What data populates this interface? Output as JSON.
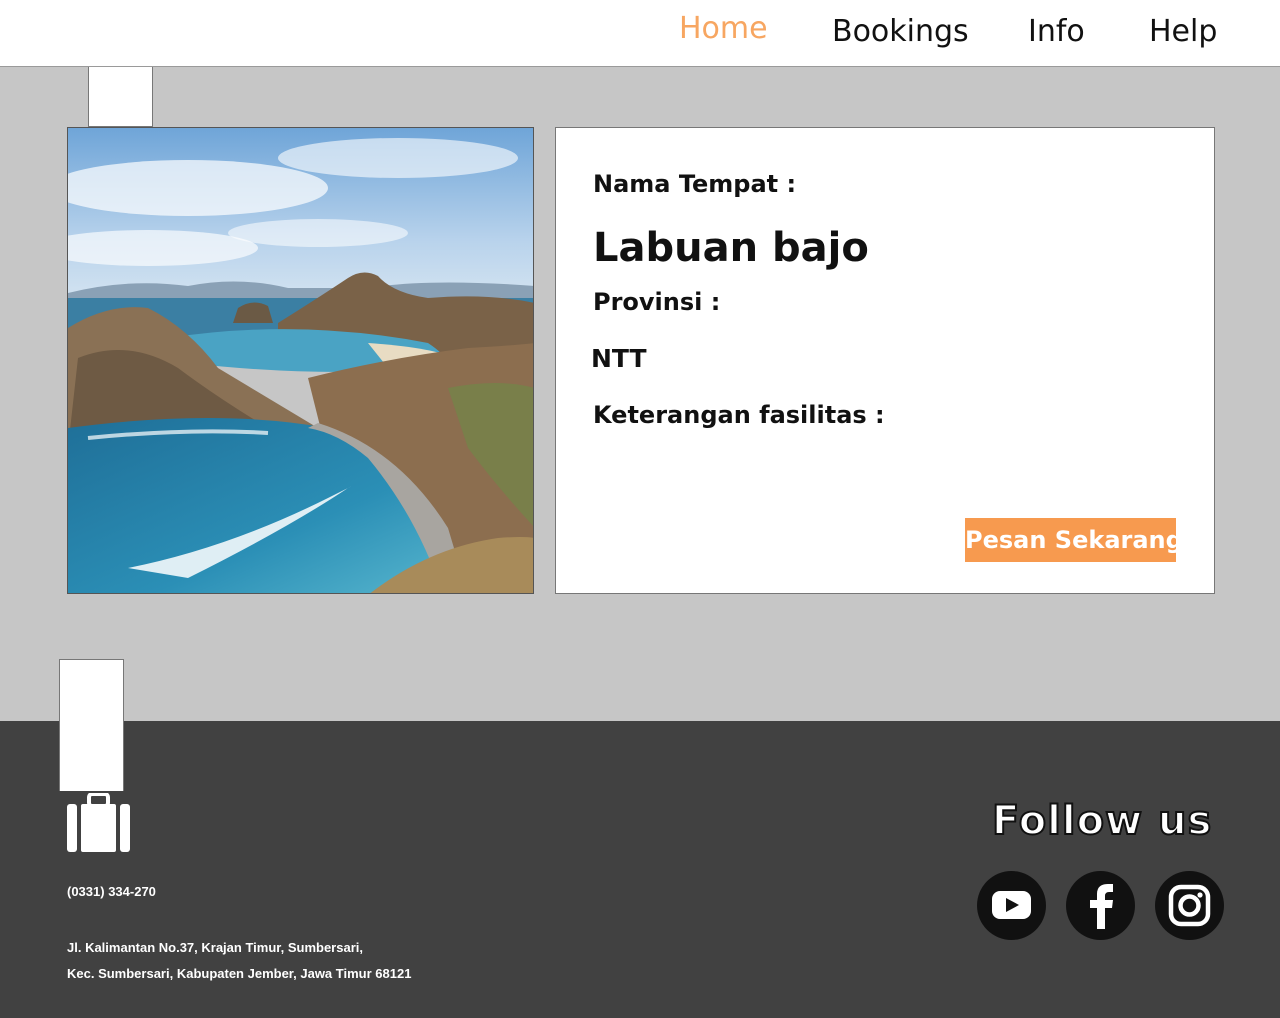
{
  "nav": {
    "items": [
      {
        "label": "Home",
        "active": true
      },
      {
        "label": "Bookings",
        "active": false
      },
      {
        "label": "Info",
        "active": false
      },
      {
        "label": "Help",
        "active": false
      }
    ],
    "active_color": "#f7a661"
  },
  "destination": {
    "name_label": "Nama Tempat :",
    "name_value": "Labuan bajo",
    "province_label": "Provinsi :",
    "province_value": "NTT",
    "facilities_label": "Keterangan fasilitas :",
    "book_button": "Pesan Sekarang",
    "button_color": "#f79a4f"
  },
  "footer": {
    "logo_icon": "suitcase-icon",
    "phone": "(0331) 334-270",
    "address_line1": "Jl. Kalimantan No.37, Krajan Timur, Sumbersari,",
    "address_line2": "Kec. Sumbersari, Kabupaten Jember, Jawa Timur 68121",
    "follow_label": "Follow us",
    "socials": [
      "youtube-icon",
      "facebook-icon",
      "instagram-icon"
    ]
  }
}
